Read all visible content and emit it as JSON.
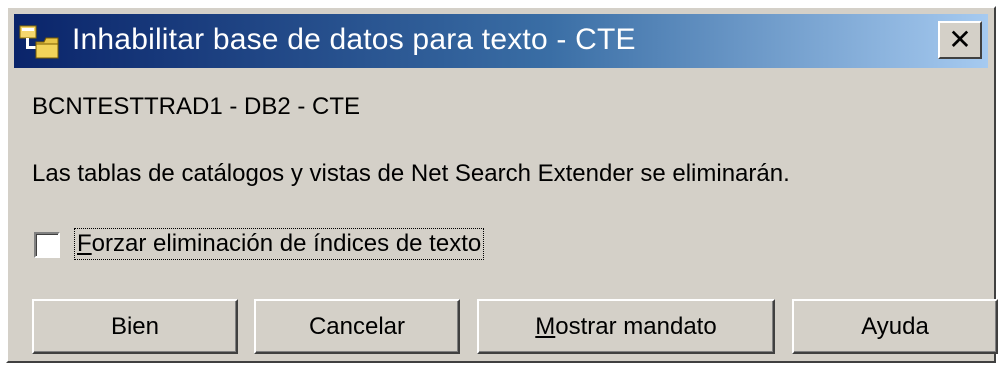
{
  "window": {
    "title": "Inhabilitar base de datos para texto - CTE",
    "close_label": "✕"
  },
  "header": {
    "subtitle": "BCNTESTTRAD1 - DB2 - CTE"
  },
  "message": "Las tablas de catálogos y vistas de Net Search Extender se eliminarán.",
  "options": {
    "force_checkbox": {
      "label_first_letter": "F",
      "label_rest": "orzar eliminación de índices de texto",
      "checked": false
    }
  },
  "buttons": {
    "ok": "Bien",
    "cancel": "Cancelar",
    "show_command_mnemonic": "M",
    "show_command_rest": "ostrar mandato",
    "help": "Ayuda"
  },
  "colors": {
    "titlebar_start": "#0a246a",
    "titlebar_end": "#a6caf0",
    "dialog_face": "#d4d0c8"
  },
  "icons": {
    "title_icon": "database-folder-icon",
    "close": "close-icon"
  }
}
